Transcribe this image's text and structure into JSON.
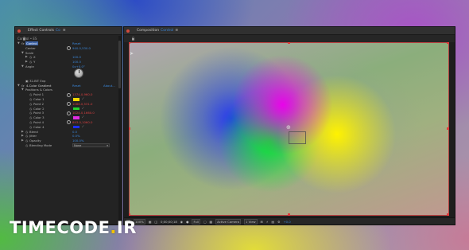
{
  "effect_controls": {
    "tab_title": "Effect Controls",
    "tab_suffix": "Co",
    "subtitle": "Control • ES",
    "layer_row": {
      "fx": "fx",
      "name": "Control",
      "reset": "Reset"
    },
    "center": {
      "label": "Center",
      "value": "940.0,530.0"
    },
    "scale": {
      "label": "Scale"
    },
    "x_row": {
      "label": "X",
      "value": "100.0"
    },
    "y_row": {
      "label": "Y",
      "value": "100.0"
    },
    "angle": {
      "label": "Angle",
      "value": "0x+0.0°"
    },
    "bit_depth": {
      "label": "32-BIT Exp"
    },
    "four_color": {
      "label": "4-Color Gradient",
      "reset": "Reset",
      "about": "About..."
    },
    "positions_colors": {
      "label": "Positions & Colors"
    },
    "points": [
      {
        "label": "Point 1",
        "value": "1374.0,960.0"
      },
      {
        "label": "Color 1",
        "color": "#f3d700"
      },
      {
        "label": "Point 2",
        "value": "1086.0,531.0"
      },
      {
        "label": "Color 2",
        "color": "#22d22c"
      },
      {
        "label": "Point 3",
        "value": "1024.0,1660.0"
      },
      {
        "label": "Color 3",
        "color": "#e22de2"
      },
      {
        "label": "Point 4",
        "value": "893.0,1060.0"
      },
      {
        "label": "Color 4",
        "color": "#1d2ef0"
      }
    ],
    "blend": {
      "label": "Blend",
      "value": "0.0"
    },
    "jitter": {
      "label": "Jitter",
      "value": "0.0%"
    },
    "opacity": {
      "label": "Opacity",
      "value": "100.0%"
    },
    "blending_mode": {
      "label": "Blending Mode",
      "value": "None"
    }
  },
  "composition": {
    "tab_title": "Composition",
    "tab_name": "Control",
    "tab_suffix": "≡",
    "active_tab": "Control",
    "bottom": {
      "zoom": "100%",
      "timecode": "0;00;00;18",
      "resolution": "Full",
      "camera": "Active Camera",
      "views": "1 View",
      "exposure": "+0.0"
    }
  },
  "watermark": {
    "part1": "TIMECODE",
    "dot": ".",
    "part2": "IR"
  }
}
